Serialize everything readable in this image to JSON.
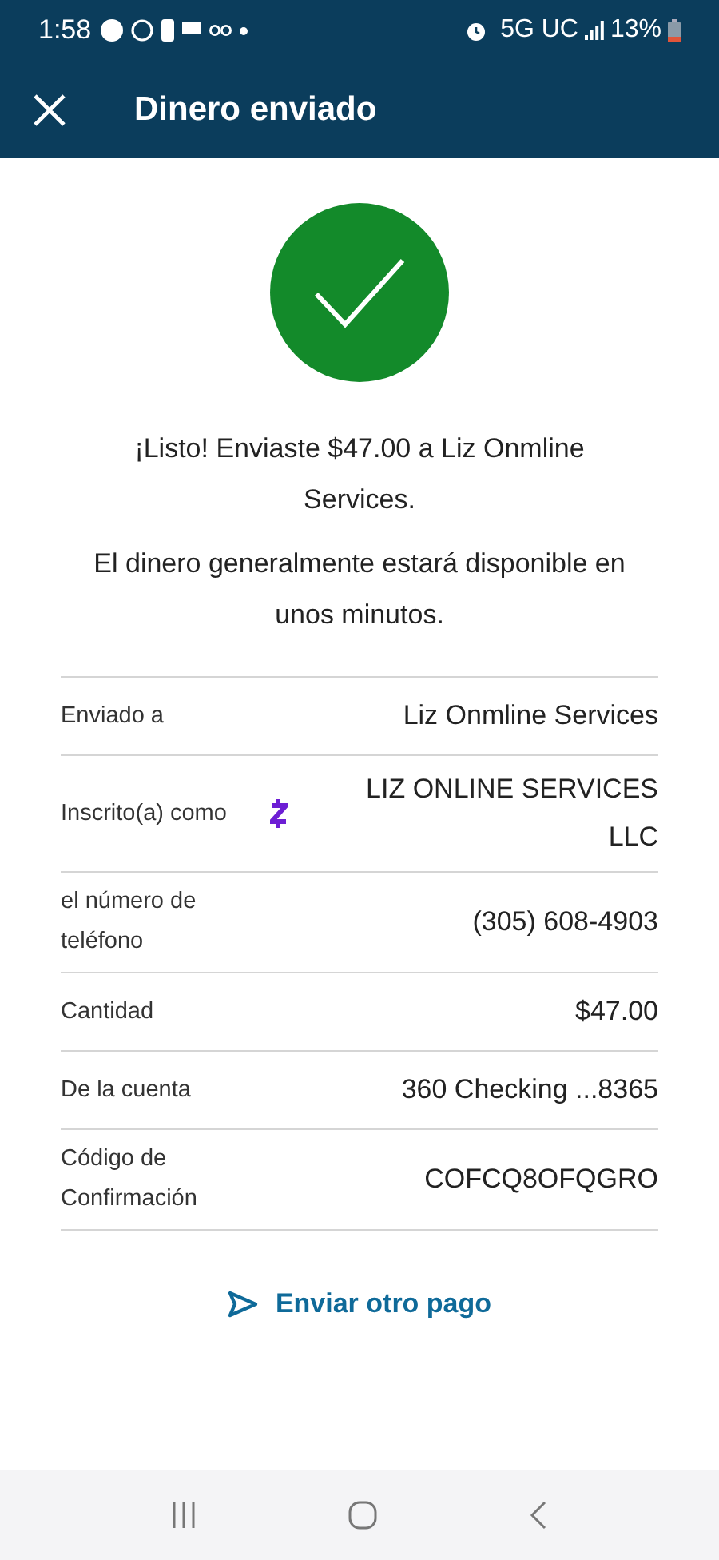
{
  "status_bar": {
    "time": "1:58",
    "network": "5G UC",
    "battery": "13%"
  },
  "header": {
    "title": "Dinero enviado"
  },
  "success": {
    "message": "¡Listo! Enviaste $47.00 a Liz Onmline Services.",
    "note": "El dinero generalmente estará disponible en unos minutos."
  },
  "details": [
    {
      "kind": "plain",
      "label": "Enviado a",
      "value": "Liz Onmline Services"
    },
    {
      "kind": "enrolled",
      "label": "Inscrito(a) como",
      "value": "LIZ ONLINE SERVICES LLC"
    },
    {
      "kind": "plain",
      "label": "el número de teléfono",
      "value": "(305) 608-4903"
    },
    {
      "kind": "plain",
      "label": "Cantidad",
      "value": "$47.00"
    },
    {
      "kind": "plain",
      "label": "De la cuenta",
      "value": "360 Checking ...8365"
    },
    {
      "kind": "plain",
      "label": "Código de Confirmación",
      "value": "COFCQ8OFQGRO"
    }
  ],
  "action": {
    "label": "Enviar otro pago"
  }
}
